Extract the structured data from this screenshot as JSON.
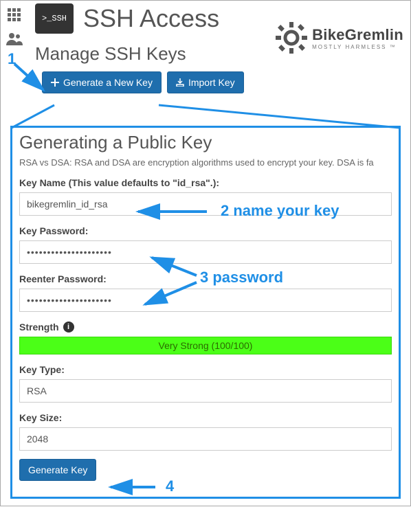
{
  "header": {
    "title": "SSH Access",
    "section": "Manage SSH Keys",
    "ssh_badge": ">_SSH"
  },
  "buttons": {
    "generate_new": "Generate a New Key",
    "import": "Import Key",
    "generate": "Generate Key"
  },
  "logo": {
    "name": "BikeGremlin",
    "tagline": "MOSTLY HARMLESS ™"
  },
  "panel": {
    "title": "Generating a Public Key",
    "desc": "RSA vs DSA: RSA and DSA are encryption algorithms used to encrypt your key. DSA is fa",
    "key_name_label": "Key Name (This value defaults to \"id_rsa\".):",
    "key_name_value": "bikegremlin_id_rsa",
    "key_password_label": "Key Password:",
    "key_password_value": "•••••••••••••••••••••",
    "reenter_label": "Reenter Password:",
    "reenter_value": "•••••••••••••••••••••",
    "strength_label": "Strength",
    "strength_text": "Very Strong (100/100)",
    "key_type_label": "Key Type:",
    "key_type_value": "RSA",
    "key_size_label": "Key Size:",
    "key_size_value": "2048"
  },
  "annotations": {
    "a1": "1",
    "a2": "2   name your key",
    "a3": "3     password",
    "a4": "4"
  }
}
